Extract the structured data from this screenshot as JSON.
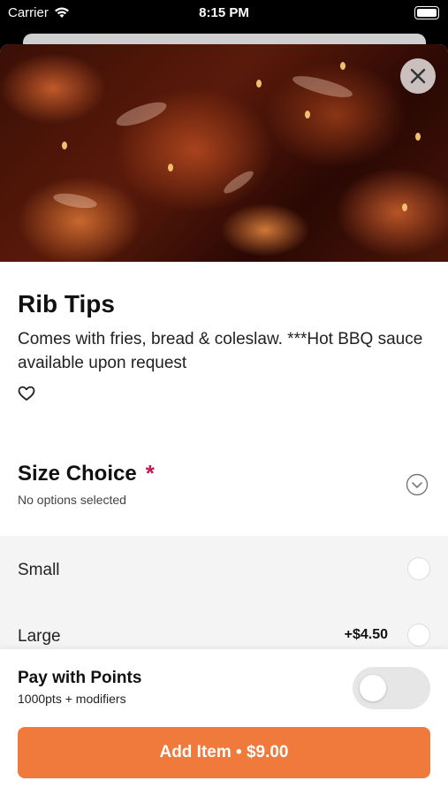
{
  "status_bar": {
    "carrier": "Carrier",
    "time": "8:15 PM"
  },
  "item": {
    "title": "Rib Tips",
    "description": "Comes with fries, bread & coleslaw. ***Hot BBQ sauce available upon request"
  },
  "size_choice": {
    "title": "Size Choice",
    "required_mark": "*",
    "subtitle": "No options selected",
    "options": [
      {
        "label": "Small",
        "price": ""
      },
      {
        "label": "Large",
        "price": "+$4.50"
      }
    ]
  },
  "points": {
    "title": "Pay with Points",
    "subtitle": "1000pts + modifiers",
    "enabled": false
  },
  "add_button": {
    "label": "Add Item • $9.00"
  },
  "colors": {
    "accent": "#f07a3c",
    "required": "#c2185b"
  }
}
